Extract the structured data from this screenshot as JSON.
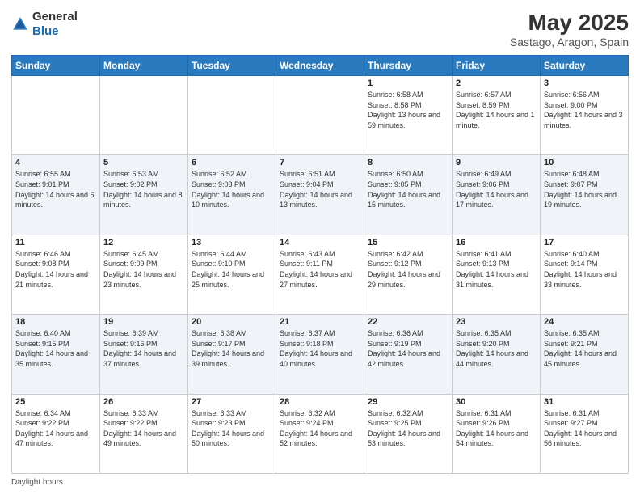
{
  "header": {
    "logo_general": "General",
    "logo_blue": "Blue",
    "month_title": "May 2025",
    "location": "Sastago, Aragon, Spain"
  },
  "days_of_week": [
    "Sunday",
    "Monday",
    "Tuesday",
    "Wednesday",
    "Thursday",
    "Friday",
    "Saturday"
  ],
  "footer": {
    "daylight_label": "Daylight hours"
  },
  "weeks": [
    [
      {
        "day": "",
        "info": ""
      },
      {
        "day": "",
        "info": ""
      },
      {
        "day": "",
        "info": ""
      },
      {
        "day": "",
        "info": ""
      },
      {
        "day": "1",
        "info": "Sunrise: 6:58 AM\nSunset: 8:58 PM\nDaylight: 13 hours and 59 minutes."
      },
      {
        "day": "2",
        "info": "Sunrise: 6:57 AM\nSunset: 8:59 PM\nDaylight: 14 hours and 1 minute."
      },
      {
        "day": "3",
        "info": "Sunrise: 6:56 AM\nSunset: 9:00 PM\nDaylight: 14 hours and 3 minutes."
      }
    ],
    [
      {
        "day": "4",
        "info": "Sunrise: 6:55 AM\nSunset: 9:01 PM\nDaylight: 14 hours and 6 minutes."
      },
      {
        "day": "5",
        "info": "Sunrise: 6:53 AM\nSunset: 9:02 PM\nDaylight: 14 hours and 8 minutes."
      },
      {
        "day": "6",
        "info": "Sunrise: 6:52 AM\nSunset: 9:03 PM\nDaylight: 14 hours and 10 minutes."
      },
      {
        "day": "7",
        "info": "Sunrise: 6:51 AM\nSunset: 9:04 PM\nDaylight: 14 hours and 13 minutes."
      },
      {
        "day": "8",
        "info": "Sunrise: 6:50 AM\nSunset: 9:05 PM\nDaylight: 14 hours and 15 minutes."
      },
      {
        "day": "9",
        "info": "Sunrise: 6:49 AM\nSunset: 9:06 PM\nDaylight: 14 hours and 17 minutes."
      },
      {
        "day": "10",
        "info": "Sunrise: 6:48 AM\nSunset: 9:07 PM\nDaylight: 14 hours and 19 minutes."
      }
    ],
    [
      {
        "day": "11",
        "info": "Sunrise: 6:46 AM\nSunset: 9:08 PM\nDaylight: 14 hours and 21 minutes."
      },
      {
        "day": "12",
        "info": "Sunrise: 6:45 AM\nSunset: 9:09 PM\nDaylight: 14 hours and 23 minutes."
      },
      {
        "day": "13",
        "info": "Sunrise: 6:44 AM\nSunset: 9:10 PM\nDaylight: 14 hours and 25 minutes."
      },
      {
        "day": "14",
        "info": "Sunrise: 6:43 AM\nSunset: 9:11 PM\nDaylight: 14 hours and 27 minutes."
      },
      {
        "day": "15",
        "info": "Sunrise: 6:42 AM\nSunset: 9:12 PM\nDaylight: 14 hours and 29 minutes."
      },
      {
        "day": "16",
        "info": "Sunrise: 6:41 AM\nSunset: 9:13 PM\nDaylight: 14 hours and 31 minutes."
      },
      {
        "day": "17",
        "info": "Sunrise: 6:40 AM\nSunset: 9:14 PM\nDaylight: 14 hours and 33 minutes."
      }
    ],
    [
      {
        "day": "18",
        "info": "Sunrise: 6:40 AM\nSunset: 9:15 PM\nDaylight: 14 hours and 35 minutes."
      },
      {
        "day": "19",
        "info": "Sunrise: 6:39 AM\nSunset: 9:16 PM\nDaylight: 14 hours and 37 minutes."
      },
      {
        "day": "20",
        "info": "Sunrise: 6:38 AM\nSunset: 9:17 PM\nDaylight: 14 hours and 39 minutes."
      },
      {
        "day": "21",
        "info": "Sunrise: 6:37 AM\nSunset: 9:18 PM\nDaylight: 14 hours and 40 minutes."
      },
      {
        "day": "22",
        "info": "Sunrise: 6:36 AM\nSunset: 9:19 PM\nDaylight: 14 hours and 42 minutes."
      },
      {
        "day": "23",
        "info": "Sunrise: 6:35 AM\nSunset: 9:20 PM\nDaylight: 14 hours and 44 minutes."
      },
      {
        "day": "24",
        "info": "Sunrise: 6:35 AM\nSunset: 9:21 PM\nDaylight: 14 hours and 45 minutes."
      }
    ],
    [
      {
        "day": "25",
        "info": "Sunrise: 6:34 AM\nSunset: 9:22 PM\nDaylight: 14 hours and 47 minutes."
      },
      {
        "day": "26",
        "info": "Sunrise: 6:33 AM\nSunset: 9:22 PM\nDaylight: 14 hours and 49 minutes."
      },
      {
        "day": "27",
        "info": "Sunrise: 6:33 AM\nSunset: 9:23 PM\nDaylight: 14 hours and 50 minutes."
      },
      {
        "day": "28",
        "info": "Sunrise: 6:32 AM\nSunset: 9:24 PM\nDaylight: 14 hours and 52 minutes."
      },
      {
        "day": "29",
        "info": "Sunrise: 6:32 AM\nSunset: 9:25 PM\nDaylight: 14 hours and 53 minutes."
      },
      {
        "day": "30",
        "info": "Sunrise: 6:31 AM\nSunset: 9:26 PM\nDaylight: 14 hours and 54 minutes."
      },
      {
        "day": "31",
        "info": "Sunrise: 6:31 AM\nSunset: 9:27 PM\nDaylight: 14 hours and 56 minutes."
      }
    ]
  ]
}
